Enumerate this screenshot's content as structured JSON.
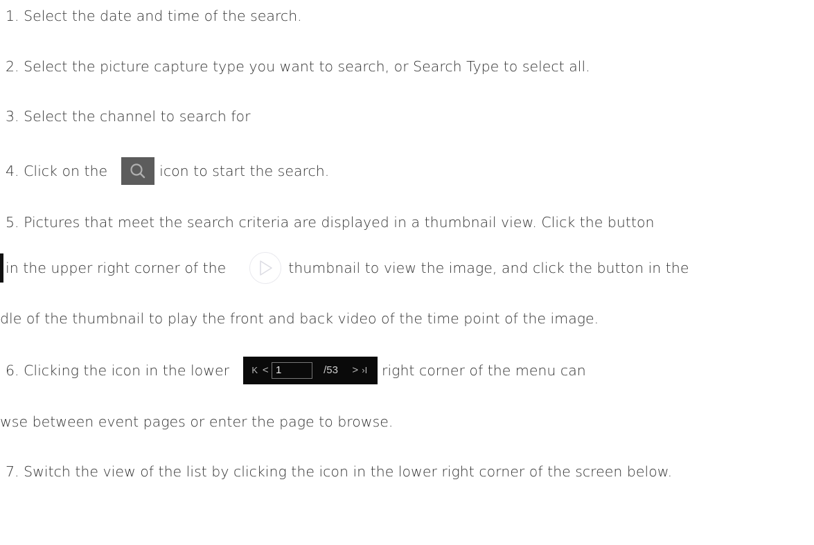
{
  "steps": {
    "s1": "1.  Select the date and time of the search.",
    "s2": "2.  Select the picture capture type you want to search, or Search Type to select all.",
    "s3": "3.  Select the channel to search for",
    "s4_before": "4.  Click on the",
    "s4_after": "icon to start the search.",
    "s5": "5.  Pictures that meet the search criteria are displayed in a thumbnail view. Click the button",
    "s5b_before": "in the upper right corner of the",
    "s5b_after": "thumbnail to view the image, and click the button in the",
    "s5c": "dle of the thumbnail to play the front and back video of the time point of the image.",
    "s6_before": "6.   Clicking the icon in the lower",
    "s6_after": "right corner of the menu can",
    "s6b": "wse between event pages or enter the page to browse.",
    "s7": "7.   Switch the view of the list by clicking the icon in the lower right corner of the screen below."
  },
  "pager": {
    "first": "K",
    "prev": "<",
    "current_page": "1",
    "total": "/53",
    "next": ">",
    "last": "›I"
  },
  "icons": {
    "search": "search-icon",
    "play": "play-icon"
  },
  "colors": {
    "text": "#333333",
    "search_bg": "#5c5c5c",
    "pager_bg": "#0a0a0a"
  }
}
